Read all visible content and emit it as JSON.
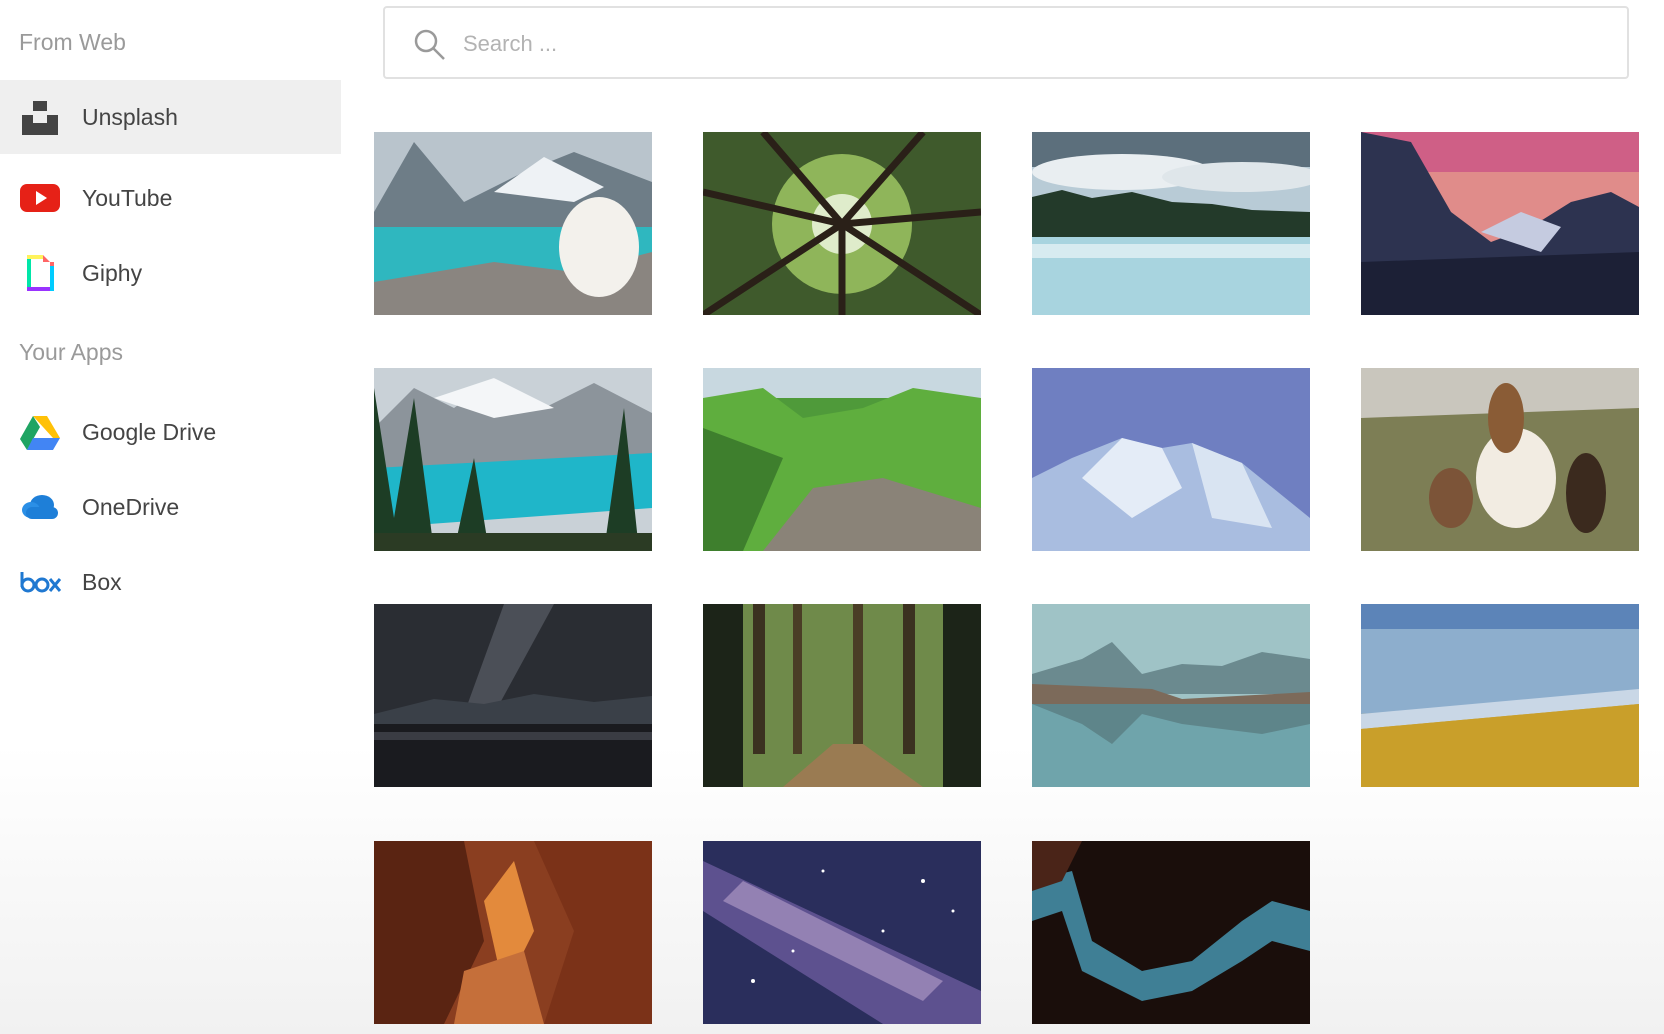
{
  "sidebar": {
    "from_web_label": "From Web",
    "your_apps_label": "Your Apps",
    "web_sources": [
      {
        "label": "Unsplash",
        "icon": "unsplash-icon",
        "active": true
      },
      {
        "label": "YouTube",
        "icon": "youtube-icon"
      },
      {
        "label": "Giphy",
        "icon": "giphy-icon"
      }
    ],
    "apps": [
      {
        "label": "Google Drive",
        "icon": "google-drive-icon"
      },
      {
        "label": "OneDrive",
        "icon": "onedrive-icon"
      },
      {
        "label": "Box",
        "icon": "box-icon"
      }
    ]
  },
  "search": {
    "placeholder": "Search ...",
    "value": ""
  },
  "colors": {
    "active_bg": "#efefef",
    "youtube_red": "#e62117",
    "onedrive_blue": "#1e7fd8",
    "box_blue": "#1f78d1"
  },
  "gallery": [
    {
      "subject": "turquoise lake with white dog and mountains"
    },
    {
      "subject": "looking up at tall tree canopy"
    },
    {
      "subject": "misty lake with forest and clouds"
    },
    {
      "subject": "mountain valley at pink sunset"
    },
    {
      "subject": "turquoise glacial lake with snowy peaks"
    },
    {
      "subject": "green forest with rocky creek"
    },
    {
      "subject": "snowy mountain under blue sky"
    },
    {
      "subject": "horses in a meadow"
    },
    {
      "subject": "milky way over dark lake"
    },
    {
      "subject": "forest path among tall trees"
    },
    {
      "subject": "mountain reflection in calm lake"
    },
    {
      "subject": "snowy forest above yellow trees"
    },
    {
      "subject": "red sandstone slot canyon"
    },
    {
      "subject": "purple starry night sky"
    },
    {
      "subject": "dark canyon with blue sky opening"
    }
  ]
}
